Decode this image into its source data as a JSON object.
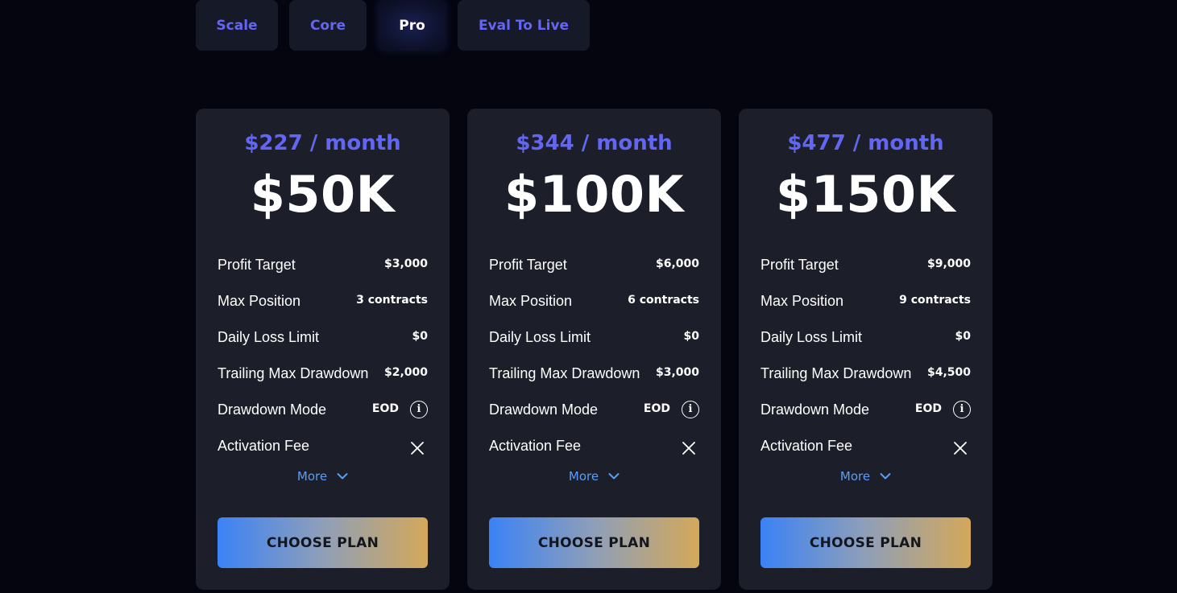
{
  "tabs": [
    {
      "label": "Scale",
      "active": false
    },
    {
      "label": "Core",
      "active": false
    },
    {
      "label": "Pro",
      "active": true
    },
    {
      "label": "Eval To Live",
      "active": false
    }
  ],
  "row_labels": {
    "profit_target": "Profit Target",
    "max_position": "Max Position",
    "daily_loss_limit": "Daily Loss Limit",
    "trailing_max_drawdown": "Trailing Max Drawdown",
    "drawdown_mode": "Drawdown Mode",
    "activation_fee": "Activation Fee"
  },
  "more_label": "More",
  "choose_label": "CHOOSE PLAN",
  "plans": [
    {
      "price": "$227 / month",
      "size": "$50K",
      "profit_target": "$3,000",
      "max_position": "3 contracts",
      "daily_loss_limit": "$0",
      "trailing_max_drawdown": "$2,000",
      "drawdown_mode": "EOD",
      "activation_fee_icon": "x-icon"
    },
    {
      "price": "$344 / month",
      "size": "$100K",
      "profit_target": "$6,000",
      "max_position": "6 contracts",
      "daily_loss_limit": "$0",
      "trailing_max_drawdown": "$3,000",
      "drawdown_mode": "EOD",
      "activation_fee_icon": "x-icon"
    },
    {
      "price": "$477 / month",
      "size": "$150K",
      "profit_target": "$9,000",
      "max_position": "9 contracts",
      "daily_loss_limit": "$0",
      "trailing_max_drawdown": "$4,500",
      "drawdown_mode": "EOD",
      "activation_fee_icon": "x-icon"
    }
  ],
  "colors": {
    "background": "#04050f",
    "card": "#1c1f29",
    "accent": "#6366f1",
    "link": "#5b9cf5",
    "button_gradient_start": "#3b82f6",
    "button_gradient_end": "#d4a85a"
  }
}
